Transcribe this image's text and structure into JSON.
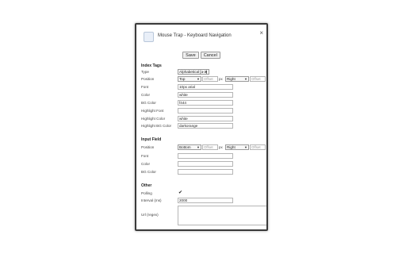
{
  "dialog": {
    "title": "Mouse Trap - Keyboard Navigation",
    "close_label": "×",
    "save_label": "Save",
    "cancel_label": "Cancel",
    "icon": "mouse-trap-app-icon"
  },
  "index_tags": {
    "heading": "Index Tags",
    "type_label": "Type",
    "type_value": "Alphabetical [a-z]",
    "position_label": "Position",
    "position_vertical": "Top",
    "position_vertical_offset_placeholder": "Offset",
    "position_horizontal": "Right",
    "position_horizontal_offset_placeholder": "Offset",
    "px_unit": "px",
    "font_label": "Font",
    "font_value": "10px arial",
    "color_label": "Color",
    "color_value": "white",
    "bg_color_label": "BG Color",
    "bg_color_value": "f444",
    "highlight_font_label": "Highlight Font",
    "highlight_font_value": "",
    "highlight_color_label": "Highlight Color",
    "highlight_color_value": "white",
    "highlight_bg_color_label": "Highlight BG Color",
    "highlight_bg_color_value": "darkorange"
  },
  "input_field": {
    "heading": "Input Field",
    "position_label": "Position",
    "position_vertical": "Bottom",
    "position_vertical_offset_placeholder": "Offset",
    "position_horizontal": "Right",
    "position_horizontal_offset_placeholder": "Offset",
    "px_unit": "px",
    "font_label": "Font",
    "font_value": "",
    "color_label": "Color",
    "color_value": "",
    "bg_color_label": "BG Color",
    "bg_color_value": ""
  },
  "other": {
    "heading": "Other",
    "polling_label": "Polling",
    "polling_checked": "✔",
    "interval_label": "Interval (ms)",
    "interval_value": "2000",
    "url_regex_label": "Url (regex)",
    "url_regex_value": ""
  }
}
